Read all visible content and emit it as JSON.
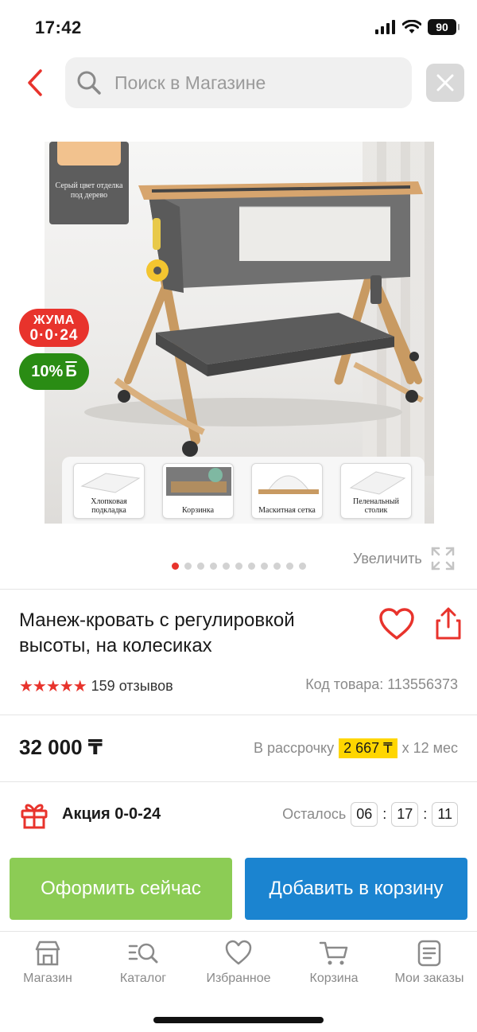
{
  "status_bar": {
    "time": "17:42",
    "battery": "90",
    "icons": [
      "signal-icon",
      "wifi-icon",
      "battery-icon"
    ]
  },
  "search": {
    "placeholder": "Поиск в Магазине",
    "icons": [
      "back-arrow-icon",
      "search-icon",
      "close-icon"
    ]
  },
  "gallery": {
    "swatch_text": "Серый цвет отделка под дерево",
    "thumbnails": [
      {
        "caption": "Хлопковая подкладка"
      },
      {
        "caption": "Корзинка"
      },
      {
        "caption": "Маскитная сетка"
      },
      {
        "caption": "Пеленальный столик"
      }
    ],
    "badge_juma_line1": "ЖУМА",
    "badge_juma_line2": "0·0·24",
    "badge_bonus": "10%",
    "badge_bonus_currency": "Б",
    "dots_total": 11,
    "dots_active_index": 0,
    "zoom_label": "Увеличить"
  },
  "product": {
    "title": "Манеж-кровать с регулировкой высоты, на колесиках",
    "rating_stars": 5,
    "stars_text": "★★★★★",
    "reviews": "159 отзывов",
    "sku": "Код товара: 113556373"
  },
  "price": {
    "value": "32 000 ₸",
    "installment_prefix": "В рассрочку",
    "installment_amount": "2 667 ₸",
    "installment_suffix": "x 12 мес"
  },
  "promo": {
    "label": "Акция 0-0-24",
    "remaining_label": "Осталось",
    "hours": "06",
    "minutes": "17",
    "seconds": "11"
  },
  "actions": {
    "buy_now": "Оформить сейчас",
    "add_to_cart": "Добавить в корзину"
  },
  "tabbar": [
    {
      "label": "Магазин",
      "icon": "store-icon"
    },
    {
      "label": "Каталог",
      "icon": "catalog-search-icon"
    },
    {
      "label": "Избранное",
      "icon": "heart-icon"
    },
    {
      "label": "Корзина",
      "icon": "cart-icon"
    },
    {
      "label": "Мои заказы",
      "icon": "orders-icon"
    }
  ],
  "colors": {
    "accent_red": "#e8332c",
    "buy_green": "#8ccc55",
    "cart_blue": "#1b84d0",
    "bonus_green": "#2a8c14",
    "installment_yellow": "#ffd600"
  }
}
